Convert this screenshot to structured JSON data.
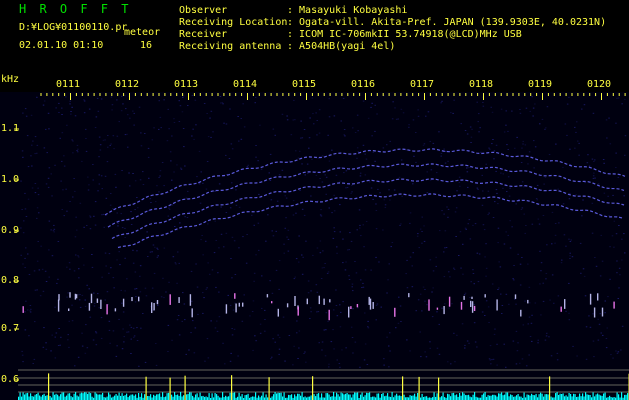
{
  "header": {
    "app_title": "H R O F F T",
    "file_path": "D:¥LOG¥01100110.pr",
    "mode": "meteor",
    "timestamp": "02.01.10 01:10",
    "count": "16",
    "fields": [
      {
        "label": "Observer",
        "value": ": Masayuki Kobayashi"
      },
      {
        "label": "Receiving Location",
        "value": ": Ogata-vill. Akita-Pref. JAPAN (139.9303E, 40.0231N)"
      },
      {
        "label": "Receiver",
        "value": ": ICOM IC-706mkII 53.74918(@LCD)MHz USB"
      },
      {
        "label": "Receiving antenna",
        "value": ": A504HB(yagi 4el)"
      }
    ]
  },
  "spectrogram": {
    "y_unit": "kHz",
    "y_ticks": [
      "1.1",
      "1.0",
      "0.9",
      "0.8",
      "0.7",
      "0.6"
    ],
    "time_ticks": [
      "0111",
      "0112",
      "0113",
      "0114",
      "0115",
      "0116",
      "0117",
      "0118",
      "0119",
      "0120"
    ],
    "colors": {
      "background": "#000010",
      "noise": "#1a1a6a",
      "trace": "#6a6aff",
      "meteor": "#c8c8ff",
      "axis_text": "#ffff40",
      "baseline": "#00ffff"
    }
  }
}
